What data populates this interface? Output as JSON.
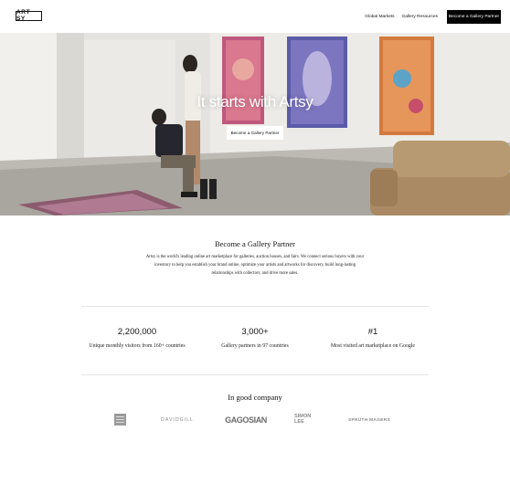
{
  "header": {
    "logo_text": "ART SY",
    "nav": {
      "global_markets": "Global Markets",
      "gallery_resources": "Gallery Resources",
      "cta": "Become a Gallery Partner"
    }
  },
  "hero": {
    "title": "It starts with Artsy",
    "cta": "Become a Gallery Partner"
  },
  "intro": {
    "title": "Become a Gallery Partner",
    "body": "Artsy is the world's leading online art marketplace for galleries, auction houses, and fairs. We connect serious buyers with your inventory to help you establish your brand online, optimize your artists and artworks for discovery, build long-lasting relationships with collectors, and drive more sales."
  },
  "stats": [
    {
      "value": "2,200,000",
      "label": "Unique monthly visitors from 160+ countries"
    },
    {
      "value": "3,000+",
      "label": "Gallery partners in 97 countries"
    },
    {
      "value": "#1",
      "label": "Most visited art marketplace on Google"
    }
  ],
  "company": {
    "title": "In good company",
    "partners": [
      {
        "name": "gallery-block-logo",
        "text": ""
      },
      {
        "name": "david-gill-logo",
        "text": "DAVIDGILL"
      },
      {
        "name": "gagosian-logo",
        "text": "GAGOSIAN"
      },
      {
        "name": "simon-lee-logo",
        "text": "SIMON LEE"
      },
      {
        "name": "spruth-magers-logo",
        "text": "SPRÜTH MAGERS"
      }
    ]
  }
}
